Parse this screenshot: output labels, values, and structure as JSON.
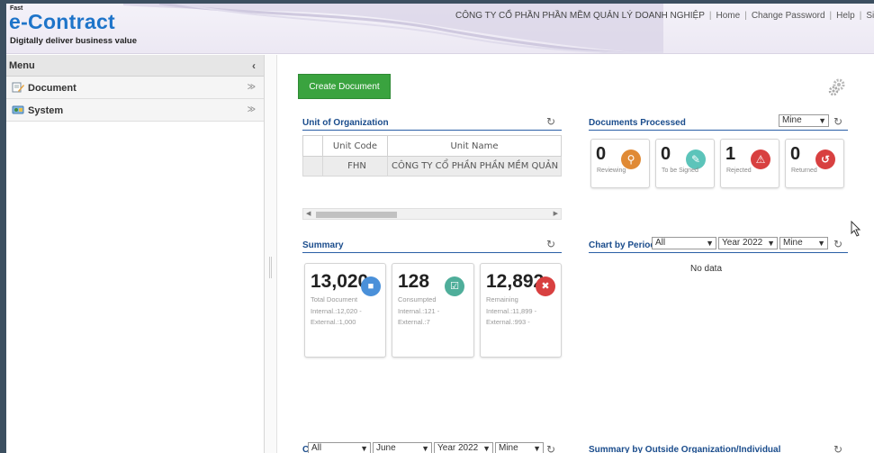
{
  "header": {
    "logo_small": "Fast",
    "logo_main": "e-Contract",
    "logo_tagline": "Digitally deliver business value",
    "company": "CÔNG TY CỔ PHẦN PHẦN MỀM QUẢN LÝ DOANH NGHIỆP",
    "nav": [
      "Home",
      "Change Password",
      "Help",
      "Sign O"
    ]
  },
  "sidebar": {
    "title": "Menu",
    "collapse_icon": "‹",
    "items": [
      {
        "label": "Document",
        "icon": "document-edit-icon"
      },
      {
        "label": "System",
        "icon": "system-icon"
      }
    ]
  },
  "main": {
    "create_button": "Create Document",
    "unit_panel": {
      "title": "Unit of Organization",
      "columns": [
        "Unit Code",
        "Unit Name"
      ],
      "rows": [
        [
          "FHN",
          "CÔNG TY CỔ PHẦN PHẦN MỀM QUẢN"
        ]
      ]
    },
    "docs_panel": {
      "title": "Documents Processed",
      "filter": "Mine",
      "cards": [
        {
          "count": "0",
          "label": "Reviewing",
          "color": "#e08a35",
          "icon": "search-icon"
        },
        {
          "count": "0",
          "label": "To be Signed",
          "color": "#5cc4ba",
          "icon": "sign-icon"
        },
        {
          "count": "1",
          "label": "Rejected",
          "color": "#d84040",
          "icon": "warning-icon"
        },
        {
          "count": "0",
          "label": "Returned",
          "color": "#d84040",
          "icon": "return-icon"
        }
      ]
    },
    "summary_panel": {
      "title": "Summary",
      "cards": [
        {
          "count": "13,020",
          "label": "Total Document",
          "internal": "Internal.:12,020 -",
          "external": "External.:1,000",
          "color": "#4a90d9"
        },
        {
          "count": "128",
          "label": "Consumpted",
          "internal": "Internal.:121 -",
          "external": "External.:7",
          "color": "#4fae9a"
        },
        {
          "count": "12,892",
          "label": "Remaining",
          "internal": "Internal.:11,899 -",
          "external": "External.:993 -",
          "color": "#d84040"
        }
      ]
    },
    "chart_panel": {
      "title": "Chart by Period",
      "filter_type": "All",
      "filter_year": "Year 2022",
      "filter_owner": "Mine",
      "empty_text": "No data"
    },
    "bottom_left": {
      "title_fragment": "C",
      "filter_type": "All",
      "filter_month": "June",
      "filter_year": "Year 2022",
      "filter_owner": "Mine"
    },
    "bottom_right": {
      "title": "Summary by Outside Organization/Individual"
    }
  }
}
